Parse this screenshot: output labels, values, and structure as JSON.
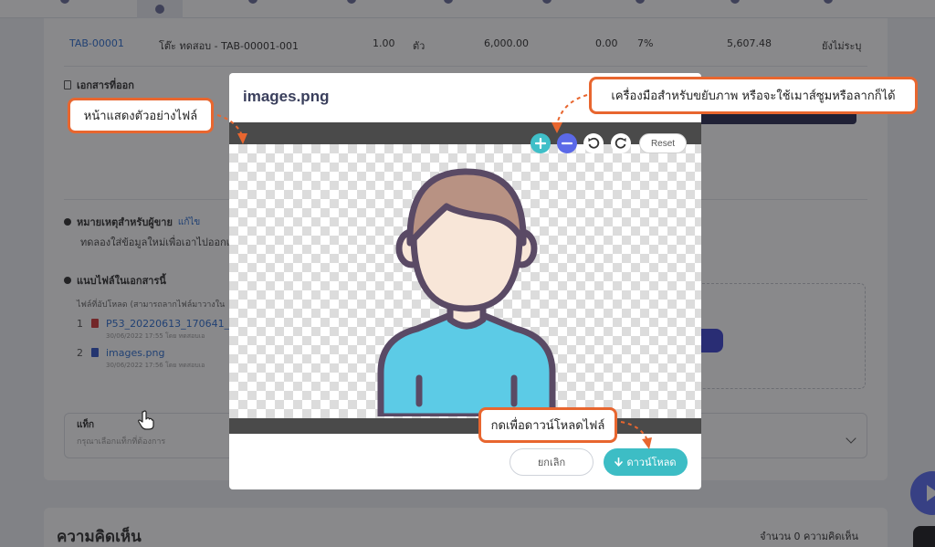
{
  "window": {
    "title": "images.png"
  },
  "background_page": {
    "line_item": {
      "code": "TAB-00001",
      "name": "โต๊ะ ทดสอบ - TAB-00001-001",
      "qty": "1.00",
      "unit": "ตัว",
      "price": "6,000.00",
      "discount": "0.00",
      "vat": "7%",
      "total": "5,607.48",
      "status": "ยังไม่ระบุ"
    },
    "sections": {
      "docs_title": "เอกสารที่ออก",
      "seller_note_title": "หมายเหตุสำหรับผู้ขาย",
      "seller_note_edit": "แก้ไข",
      "seller_note_text": "ทดลองใส่ข้อมูลใหม่เพื่อเอาไปออกเ",
      "attach_title": "แนบไฟล์ในเอกสารนี้",
      "uploaded_label": "ไฟล์ที่อัปโหลด (สามารถลากไฟล์มาวางใน",
      "files": [
        {
          "num": "1",
          "name": "P53_20220613_170641_",
          "meta": "30/06/2022 17:55 โดย ทดสอบเอ"
        },
        {
          "num": "2",
          "name": "images.png",
          "meta": "30/06/2022 17:56 โดย ทดสอบเอ"
        }
      ],
      "tag_label": "แท็ก",
      "tag_placeholder": "กรุณาเลือกแท็กที่ต้องการ"
    },
    "comments": {
      "title": "ความคิดเห็น",
      "count": "จำนวน 0 ความคิดเห็น"
    }
  },
  "modal": {
    "title": "images.png",
    "toolbar": {
      "reset_label": "Reset"
    },
    "footer": {
      "cancel_label": "ยกเลิก",
      "download_label": "ดาวน์โหลด"
    }
  },
  "callouts": {
    "preview": "หน้าแสดงตัวอย่างไฟล์",
    "tools": "เครื่องมือสำหรับขยับภาพ หรือจะใช้เมาส์ซูมหรือลากก็ได้",
    "download": "กดเพื่อดาวน์โหลดไฟล์"
  },
  "colors": {
    "accent_teal": "#3dbdc5",
    "accent_indigo": "#5b69e8",
    "callout_border": "#e8662f",
    "overlay": "rgba(20,20,24,0.5)"
  },
  "icons": [
    "zoom-in-icon",
    "zoom-out-icon",
    "rotate-left-icon",
    "rotate-right-icon",
    "download-arrow-icon",
    "avatar-image",
    "pdf-file-icon",
    "image-file-icon",
    "chevron-down-icon",
    "pointer-hand-icon",
    "play-icon"
  ]
}
